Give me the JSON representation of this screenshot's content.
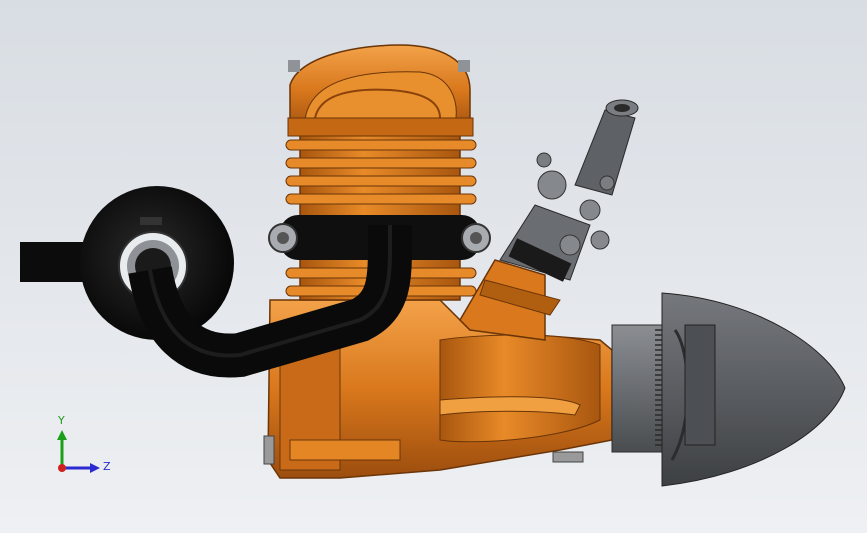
{
  "viewport": {
    "background_top": "#d8dde3",
    "background_bottom": "#eef0f3"
  },
  "model": {
    "parts": [
      "crankcase",
      "cylinder-head",
      "cooling-fins",
      "exhaust-pipe",
      "muffler",
      "carburetor",
      "prop-hub",
      "spinner"
    ],
    "colors": {
      "body": "#d9781c",
      "body_dark": "#9c4d0e",
      "body_light": "#f3a24a",
      "exhaust": "#111111",
      "carb": "#6f7276",
      "spinner": "#5a5d61",
      "hub": "#7a7d81"
    }
  },
  "triad": {
    "y_label": "Y",
    "z_label": "Z",
    "y_color": "#1b9e1b",
    "z_color": "#2a2ad0",
    "x_color": "#d01f1f"
  }
}
